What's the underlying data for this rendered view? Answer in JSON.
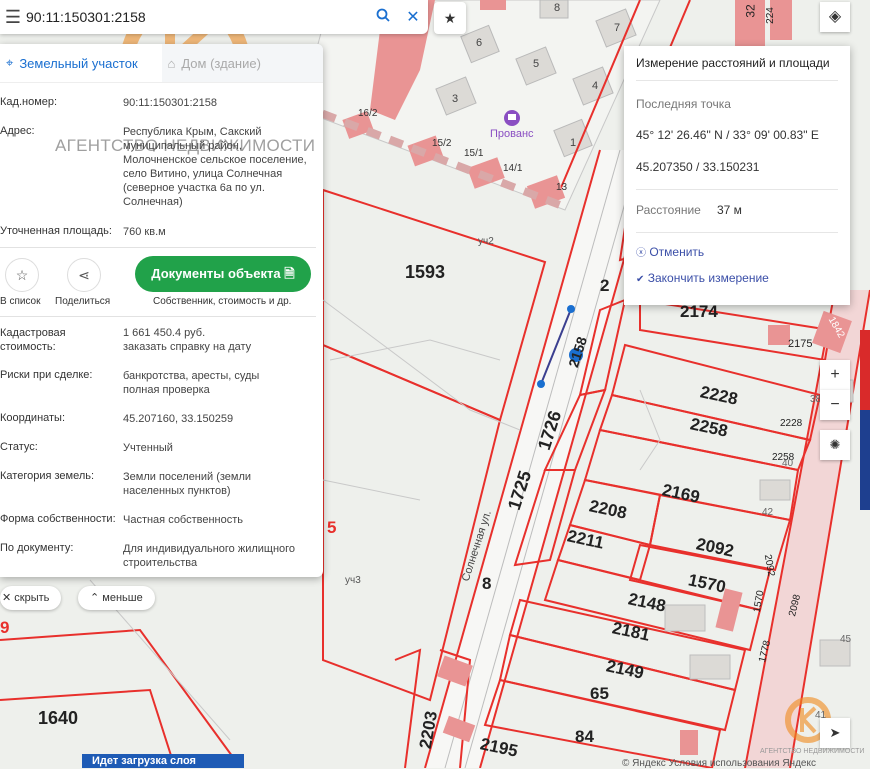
{
  "search": {
    "value": "90:11:150301:2158"
  },
  "panel": {
    "tab_active": "Земельный участок",
    "tab_inactive": "Дом (здание)",
    "watermark": "АГЕНТСТВО НЕДВИЖИМОСТИ",
    "rows": {
      "cad_key": "Кад.номер:",
      "cad_val": "90:11:150301:2158",
      "addr_key": "Адрес:",
      "addr_val": "Республика Крым, Сакский муниципальный район, Молочненское сельское поселение, село Витино, улица Солнечная (северное участка 6а по ул. Солнечная)",
      "area_key": "Уточненная площадь:",
      "area_val": "760 кв.м",
      "cost_key": "Кадастровая стоимость:",
      "cost_val": "1 661 450.4 руб.",
      "cost_link": "заказать справку на дату",
      "risk_key": "Риски при сделке:",
      "risk_val": "банкротства, аресты, суды",
      "risk_link": "полная проверка",
      "coord_key": "Координаты:",
      "coord_val": "45.207160, 33.150259",
      "status_key": "Статус:",
      "status_val": "Учтенный",
      "cat_key": "Категория земель:",
      "cat_val": "Земли поселений (земли населенных пунктов)",
      "own_key": "Форма собственности:",
      "own_val": "Частная собственность",
      "doc_key": "По документу:",
      "doc_val": "Для индивидуального жилищного строительства"
    },
    "actions": {
      "to_list": "В список",
      "share": "Поделиться",
      "docs_button": "Документы объекта",
      "docs_sub": "Собственник, стоимость и др."
    },
    "hide": "скрыть",
    "less": "меньше"
  },
  "measure": {
    "title": "Измерение расстояний и площади",
    "last_point_label": "Последняя точка",
    "dms": "45° 12' 26.46\" N / 33° 09' 00.83\" E",
    "decimal": "45.207350 / 33.150231",
    "distance_label": "Расстояние",
    "distance_value": "37 м",
    "cancel": "Отменить",
    "finish": "Закончить измерение"
  },
  "map": {
    "labels": [
      "1593",
      "1726",
      "1725",
      "2208",
      "2211",
      "2169",
      "2092",
      "1570",
      "2148",
      "2181",
      "2149",
      "65",
      "84",
      "2195",
      "2203",
      "1640",
      "2228",
      "2258",
      "2174",
      "2175",
      "2",
      "8",
      "5",
      "уч2",
      "уч3",
      "Солнечная ул.",
      "Прованс",
      "16/2",
      "15/2",
      "15/1",
      "14/1",
      "13",
      "6",
      "5",
      "4",
      "3",
      "1",
      "7",
      "8",
      "2228",
      "2258",
      "2092",
      "1570",
      "1778",
      "2098",
      "40",
      "42",
      "38",
      "45",
      "41",
      "32",
      "224",
      "1842",
      "9",
      "2158"
    ],
    "zoom_in": "+",
    "zoom_out": "−",
    "bottom_bar": "Идет загрузка слоя",
    "copyright": "© Яндекс Условия использования Яндекс",
    "logo_text": "АГЕНТСТВО НЕДВИЖИМОСТИ"
  },
  "colors": {
    "parcel": "#e8302c",
    "building": "#e99494",
    "accent": "#1a6fd0",
    "green": "#21a24a",
    "logo": "#f08a1c"
  },
  "icons": [
    "menu-icon",
    "search-icon",
    "close-icon",
    "star-icon",
    "layers-icon",
    "share-icon",
    "document-icon",
    "pin-icon",
    "house-icon",
    "navigation-icon",
    "spinner-icon",
    "compass-icon",
    "hotel-icon"
  ]
}
